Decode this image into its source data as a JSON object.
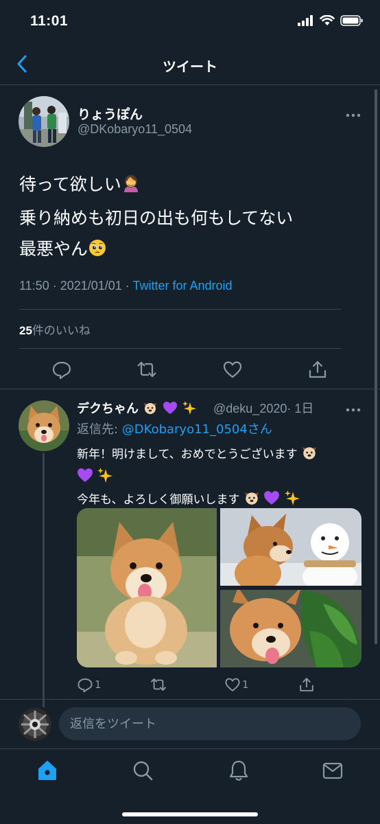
{
  "status_bar": {
    "time": "11:01"
  },
  "header": {
    "back_label": "Back",
    "title": "ツイート"
  },
  "tweet": {
    "author_name": "りょうぽん",
    "author_handle": "@DKobaryo11_0504",
    "text_lines": [
      "待って欲しい",
      "乗り納めも初日の出も何もしてない",
      "最悪やん"
    ],
    "timestamp": "11:50 · 2021/01/01 · ",
    "source_app": "Twitter for Android",
    "likes_count": "25",
    "likes_label": "件のいいね"
  },
  "reply": {
    "author_name": "デクちゃん",
    "author_handle": "@deku_2020",
    "time_ago": "· 1日",
    "reply_to_label": "返信先: ",
    "reply_to_mention": "@DKobaryo11_0504さん",
    "text_line1": "新年！明けまして、おめでとうございます",
    "text_line3": "今年も、よろしく御願いします",
    "reply_count": "1",
    "like_count": "1"
  },
  "composer": {
    "placeholder": "返信をツイート"
  },
  "colors": {
    "background": "#15202b",
    "accent": "#1da1f2",
    "muted": "#8899a6",
    "divider": "#38444d"
  },
  "icons": [
    "back-chevron-icon",
    "more-icon",
    "reply-icon",
    "retweet-icon",
    "like-icon",
    "share-icon",
    "home-icon",
    "search-icon",
    "notifications-icon",
    "messages-icon"
  ]
}
